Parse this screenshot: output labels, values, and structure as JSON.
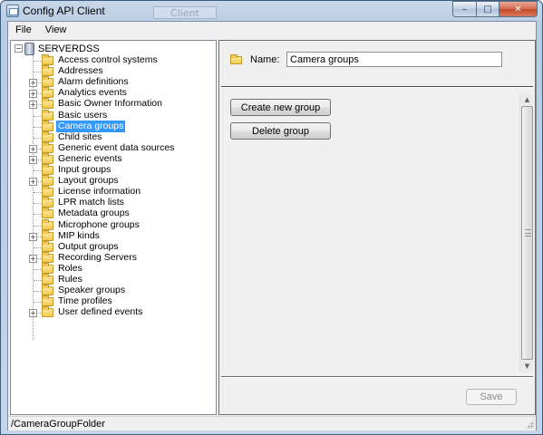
{
  "window": {
    "title": "Config API Client",
    "background_title": "Client"
  },
  "menu": {
    "items": [
      "File",
      "View"
    ]
  },
  "tree": {
    "root_label": "SERVERDSS",
    "root_expanded": true,
    "items": [
      {
        "label": "Access control systems",
        "expandable": false,
        "selected": false
      },
      {
        "label": "Addresses",
        "expandable": false,
        "selected": false
      },
      {
        "label": "Alarm definitions",
        "expandable": true,
        "selected": false
      },
      {
        "label": "Analytics events",
        "expandable": true,
        "selected": false
      },
      {
        "label": "Basic Owner Information",
        "expandable": true,
        "selected": false
      },
      {
        "label": "Basic users",
        "expandable": false,
        "selected": false
      },
      {
        "label": "Camera groups",
        "expandable": false,
        "selected": true
      },
      {
        "label": "Child sites",
        "expandable": false,
        "selected": false
      },
      {
        "label": "Generic event data sources",
        "expandable": true,
        "selected": false
      },
      {
        "label": "Generic events",
        "expandable": true,
        "selected": false
      },
      {
        "label": "Input groups",
        "expandable": false,
        "selected": false
      },
      {
        "label": "Layout groups",
        "expandable": true,
        "selected": false
      },
      {
        "label": "License information",
        "expandable": false,
        "selected": false
      },
      {
        "label": "LPR match lists",
        "expandable": false,
        "selected": false
      },
      {
        "label": "Metadata groups",
        "expandable": false,
        "selected": false
      },
      {
        "label": "Microphone groups",
        "expandable": false,
        "selected": false
      },
      {
        "label": "MIP kinds",
        "expandable": true,
        "selected": false
      },
      {
        "label": "Output groups",
        "expandable": false,
        "selected": false
      },
      {
        "label": "Recording Servers",
        "expandable": true,
        "selected": false
      },
      {
        "label": "Roles",
        "expandable": false,
        "selected": false
      },
      {
        "label": "Rules",
        "expandable": false,
        "selected": false
      },
      {
        "label": "Speaker groups",
        "expandable": false,
        "selected": false
      },
      {
        "label": "Time profiles",
        "expandable": false,
        "selected": false
      },
      {
        "label": "User defined events",
        "expandable": true,
        "selected": false
      }
    ]
  },
  "detail": {
    "name_label": "Name:",
    "name_value": "Camera groups",
    "create_button": "Create new group",
    "delete_button": "Delete group",
    "save_button": "Save",
    "save_enabled": false
  },
  "status": {
    "path": "/CameraGroupFolder"
  }
}
